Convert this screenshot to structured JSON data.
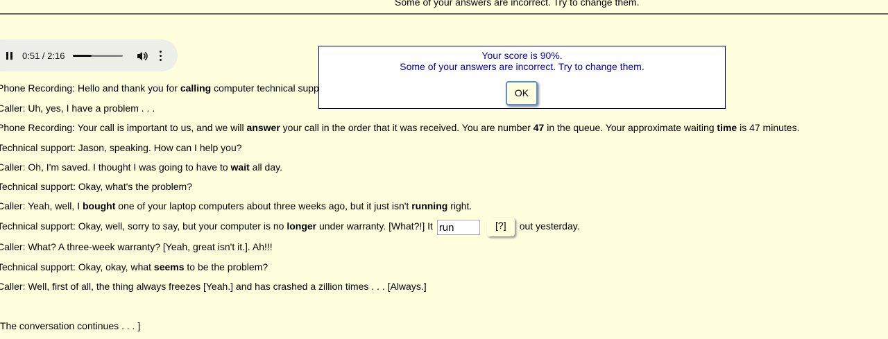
{
  "top_message": "Some of your answers are incorrect. Try to change them.",
  "audio_player": {
    "time": "0:51 / 2:16",
    "progress": 0.375,
    "icons": [
      "pause-icon",
      "volume-icon",
      "more-options-icon"
    ]
  },
  "transcript": {
    "line1": {
      "a": "Phone Recording: Hello and thank you for ",
      "b": "calling",
      "c": " computer technical supp"
    },
    "line2": {
      "a": "Caller: Uh, yes, I have a problem . . ."
    },
    "line3": {
      "a": "Phone Recording: Your call is important to us, and we will ",
      "b": "answer",
      "c": " your call in the order that it was received. You are number ",
      "d": "47",
      "e": " in the queue. Your approximate waiting ",
      "f": "time",
      "g": " is 47 minutes."
    },
    "line4": {
      "a": "Technical support: Jason, speaking. How can I help you?"
    },
    "line5": {
      "a": "Caller: Oh, I'm saved. I thought I was going to have to ",
      "b": "wait",
      "c": " all day."
    },
    "line6": {
      "a": "Technical support: Okay, what's the problem?"
    },
    "line7": {
      "a": "Caller: Yeah, well, I ",
      "b": "bought",
      "c": " one of your laptop computers about three weeks ago, but it just isn't ",
      "d": "running",
      "e": " right."
    },
    "line8": {
      "a": "Technical support: Okay, well, sorry to say, but your computer is no ",
      "b": "longer",
      "c": " under warranty. [What?!] It ",
      "input_value": "run",
      "hint": "[?]",
      "d": " out yesterday."
    },
    "line9": {
      "a": "Caller: What? A three-week warranty? [Yeah, great isn't it.]. Ah!!!"
    },
    "line10": {
      "a": "Technical support: Okay, okay, what ",
      "b": "seems",
      "c": " to be the problem?"
    },
    "line11": {
      "a": "Caller: Well, first of all, the thing always freezes [Yeah.] and has crashed a zillion times . . . [Always.]"
    },
    "line12": {
      "a": "[The conversation continues . . . ]"
    }
  },
  "dialog": {
    "line1": "Your score is 90%.",
    "line2": "Some of your answers are incorrect. Try to change them.",
    "ok_label": "OK"
  }
}
